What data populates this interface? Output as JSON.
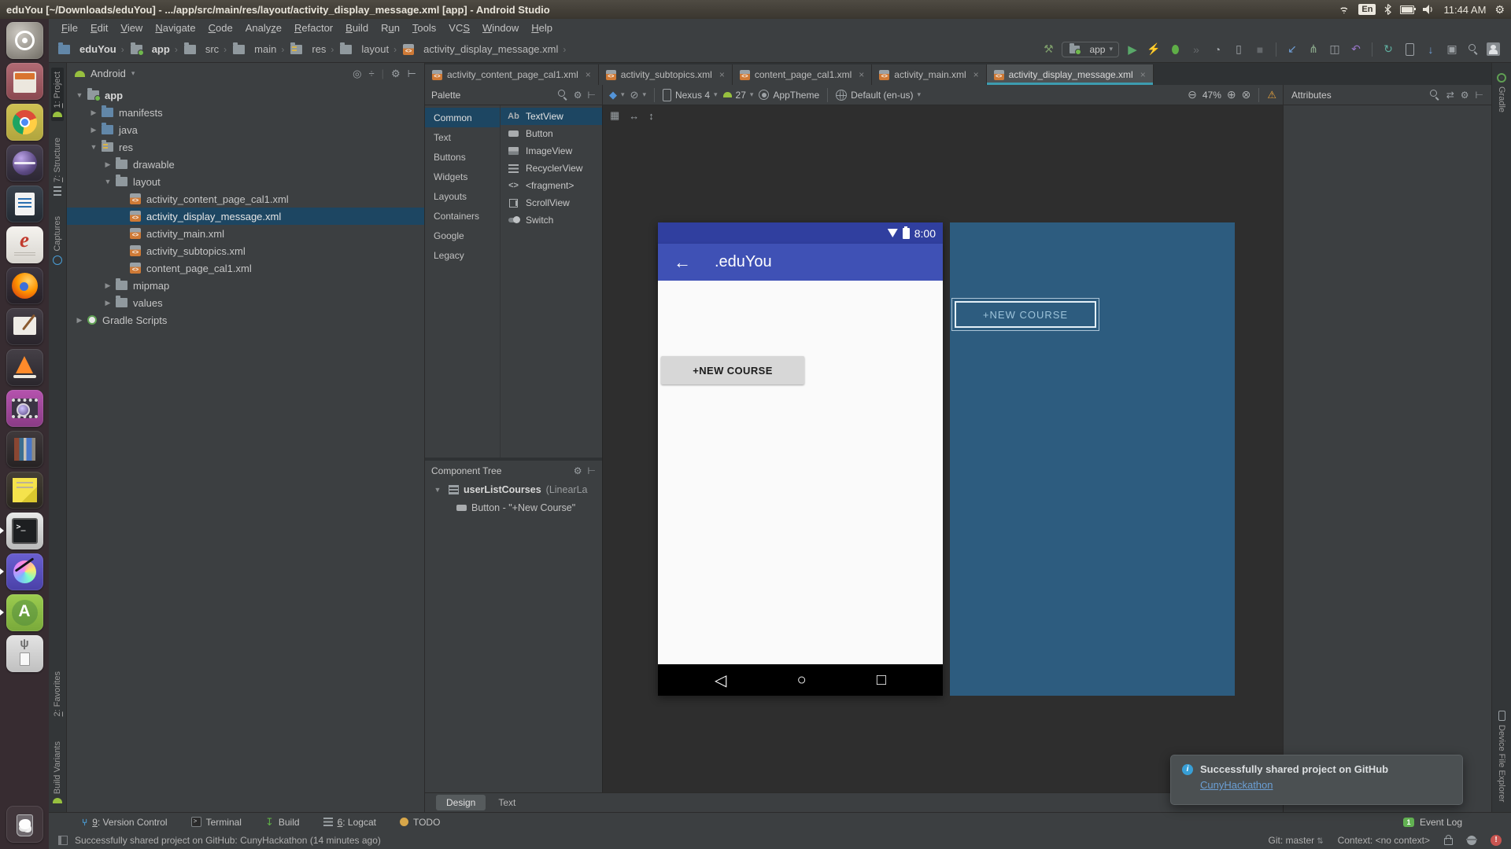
{
  "ubuntu": {
    "title": "eduYou [~/Downloads/eduYou] - .../app/src/main/res/layout/activity_display_message.xml [app] - Android Studio",
    "tray": {
      "language": "En",
      "time": "11:44 AM"
    },
    "launcher": [
      {
        "name": "ubuntu-dash",
        "cls": "ic-dash"
      },
      {
        "name": "files",
        "cls": "ic-files"
      },
      {
        "name": "chrome",
        "cls": "ic-chrome"
      },
      {
        "name": "eclipse",
        "cls": "ic-eclipse"
      },
      {
        "name": "libreoffice-writer",
        "cls": "ic-writer"
      },
      {
        "name": "document-viewer",
        "cls": "ic-evince"
      },
      {
        "name": "firefox",
        "cls": "ic-firefox"
      },
      {
        "name": "gimp",
        "cls": "ic-gimp"
      },
      {
        "name": "vlc",
        "cls": "ic-vlc"
      },
      {
        "name": "video-player",
        "cls": "ic-video"
      },
      {
        "name": "calibre",
        "cls": "ic-calibre"
      },
      {
        "name": "sticky-notes",
        "cls": "ic-notes"
      },
      {
        "name": "terminal",
        "cls": "ic-terminal",
        "running": true
      },
      {
        "name": "krita",
        "cls": "ic-krita",
        "running": true
      },
      {
        "name": "android-studio",
        "cls": "ic-studio",
        "running": true
      },
      {
        "name": "usb-creator",
        "cls": "ic-usb"
      },
      {
        "name": "trash",
        "cls": "ic-trash"
      }
    ]
  },
  "menu_bar": [
    {
      "label": "File",
      "m": 0
    },
    {
      "label": "Edit",
      "m": 0
    },
    {
      "label": "View",
      "m": 0
    },
    {
      "label": "Navigate",
      "m": 0
    },
    {
      "label": "Code",
      "m": 0
    },
    {
      "label": "Analyze",
      "m": 5
    },
    {
      "label": "Refactor",
      "m": 0
    },
    {
      "label": "Build",
      "m": 0
    },
    {
      "label": "Run",
      "m": 1
    },
    {
      "label": "Tools",
      "m": 0
    },
    {
      "label": "VCS",
      "m": 2
    },
    {
      "label": "Window",
      "m": 0
    },
    {
      "label": "Help",
      "m": 0
    }
  ],
  "breadcrumbs": [
    {
      "label": "eduYou",
      "icon": "folder-blue",
      "bold": true
    },
    {
      "label": "app",
      "icon": "module",
      "bold": true
    },
    {
      "label": "src",
      "icon": "folder"
    },
    {
      "label": "main",
      "icon": "folder"
    },
    {
      "label": "res",
      "icon": "folder-res"
    },
    {
      "label": "layout",
      "icon": "folder"
    },
    {
      "label": "activity_display_message.xml",
      "icon": "xml"
    }
  ],
  "run_widget": {
    "config": "app"
  },
  "left_stripe": {
    "top": [
      {
        "label": "1: Project",
        "icon": "project-tool",
        "active": true,
        "u": true
      },
      {
        "label": "7: Structure",
        "icon": "structure-tool",
        "u": true
      },
      {
        "label": "Captures",
        "icon": "captures-tool"
      }
    ],
    "bottom": [
      {
        "label": "2: Favorites",
        "icon": "favorites-tool",
        "u": true
      },
      {
        "label": "Build Variants",
        "icon": "build-variants-tool"
      }
    ]
  },
  "project_panel": {
    "view": "Android",
    "tree": [
      {
        "label": "app",
        "depth": 0,
        "chev": "down",
        "icon": "module",
        "bold": true
      },
      {
        "label": "manifests",
        "depth": 1,
        "chev": "right",
        "icon": "folder-blue"
      },
      {
        "label": "java",
        "depth": 1,
        "chev": "right",
        "icon": "folder-blue"
      },
      {
        "label": "res",
        "depth": 1,
        "chev": "down",
        "icon": "folder-res"
      },
      {
        "label": "drawable",
        "depth": 2,
        "chev": "right",
        "icon": "folder"
      },
      {
        "label": "layout",
        "depth": 2,
        "chev": "down",
        "icon": "folder"
      },
      {
        "label": "activity_content_page_cal1.xml",
        "depth": 3,
        "icon": "xml"
      },
      {
        "label": "activity_display_message.xml",
        "depth": 3,
        "icon": "xml",
        "selected": true
      },
      {
        "label": "activity_main.xml",
        "depth": 3,
        "icon": "xml"
      },
      {
        "label": "activity_subtopics.xml",
        "depth": 3,
        "icon": "xml"
      },
      {
        "label": "content_page_cal1.xml",
        "depth": 3,
        "icon": "xml"
      },
      {
        "label": "mipmap",
        "depth": 2,
        "chev": "right",
        "icon": "folder"
      },
      {
        "label": "values",
        "depth": 2,
        "chev": "right",
        "icon": "folder"
      },
      {
        "label": "Gradle Scripts",
        "depth": 0,
        "chev": "right",
        "icon": "gradle"
      }
    ]
  },
  "editor_tabs": [
    {
      "label": "activity_content_page_cal1.xml"
    },
    {
      "label": "activity_subtopics.xml"
    },
    {
      "label": "content_page_cal1.xml"
    },
    {
      "label": "activity_main.xml"
    },
    {
      "label": "activity_display_message.xml",
      "active": true
    }
  ],
  "palette": {
    "title": "Palette",
    "categories": [
      "Common",
      "Text",
      "Buttons",
      "Widgets",
      "Layouts",
      "Containers",
      "Google",
      "Legacy"
    ],
    "selected_category": "Common",
    "items": [
      {
        "glyph": "Ab",
        "label": "TextView",
        "selected": true
      },
      {
        "icon": "button",
        "label": "Button"
      },
      {
        "icon": "image",
        "label": "ImageView"
      },
      {
        "icon": "list",
        "label": "RecyclerView"
      },
      {
        "glyph": "<>",
        "label": "<fragment>"
      },
      {
        "icon": "scroll",
        "label": "ScrollView"
      },
      {
        "icon": "switch",
        "label": "Switch"
      }
    ]
  },
  "design_bar": {
    "device": "Nexus 4",
    "api_level": "27",
    "theme": "AppTheme",
    "locale": "Default (en-us)",
    "zoom": "47%"
  },
  "component_tree": {
    "title": "Component Tree",
    "root_name": "userListCourses",
    "root_type": "(LinearLa",
    "child_label": "Button - \"+New Course\""
  },
  "phone": {
    "status_time": "8:00",
    "app_title": ".eduYou",
    "back_glyph": "←",
    "button_label": "+NEW COURSE",
    "nav_back": "◁",
    "nav_home": "○",
    "nav_recents": "□"
  },
  "blueprint": {
    "button_label": "+NEW COURSE"
  },
  "mode_tabs": [
    {
      "label": "Design",
      "active": true
    },
    {
      "label": "Text"
    }
  ],
  "attributes": {
    "title": "Attributes"
  },
  "right_stripe": [
    {
      "label": "Gradle",
      "icon": "gradle-tool"
    },
    {
      "label": "Device File Explorer",
      "icon": "device-explorer-tool"
    }
  ],
  "bottom_bar": {
    "left": [
      {
        "label": "9: Version Control",
        "icon": "vcs",
        "u": true
      },
      {
        "label": "Terminal",
        "icon": "terminal"
      },
      {
        "label": "Build",
        "icon": "build"
      },
      {
        "label": "6: Logcat",
        "icon": "logcat",
        "u": true
      },
      {
        "label": "TODO",
        "icon": "todo"
      }
    ],
    "event_log": "Event Log"
  },
  "status_bar": {
    "message": "Successfully shared project on GitHub: CunyHackathon (14 minutes ago)",
    "git_label": "Git: master",
    "context_label": "Context: <no context>"
  },
  "notification": {
    "title": "Successfully shared project on GitHub",
    "link": "CunyHackathon"
  },
  "colors": {
    "appbar_indigo": "#3F51B5",
    "statusbar_indigo": "#303F9F",
    "blueprint_blue": "#2d5c7f",
    "selection_blue": "#1d4662",
    "tab_underline_teal": "#3d9cb0",
    "warning_orange": "#e8a33d"
  }
}
